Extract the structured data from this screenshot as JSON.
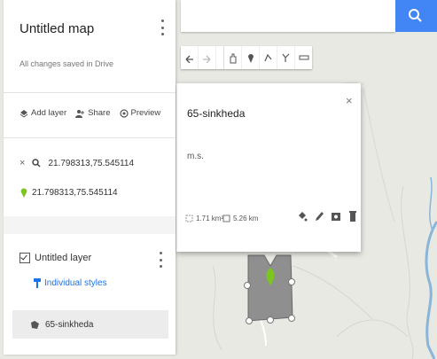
{
  "sidebar": {
    "map_title": "Untitled map",
    "saved_status": "All changes saved in Drive",
    "actions": {
      "add_layer": "Add layer",
      "share": "Share",
      "preview": "Preview"
    },
    "search_result": "21.798313,75.545114",
    "point_result": "21.798313,75.545114",
    "layer": {
      "name": "Untitled layer",
      "styles_link": "Individual styles",
      "feature": "65-sinkheda"
    }
  },
  "popup": {
    "title": "65-sinkheda",
    "description": "m.s.",
    "area": "1.71 km²",
    "perimeter": "5.26 km",
    "close_symbol": "×"
  },
  "colors": {
    "accent_blue": "#4285f4",
    "link_blue": "#1a73e8",
    "pin_green": "#7cc520",
    "polygon_fill": "#8f8f8f",
    "map_background": "#e9e9e4",
    "river": "#8ab4d8"
  },
  "icons": [
    "more-vert-icon",
    "add-layer-icon",
    "share-icon",
    "preview-icon",
    "close-icon",
    "search-icon",
    "pin-icon",
    "paint-icon",
    "edit-icon",
    "camera-icon",
    "delete-icon"
  ]
}
